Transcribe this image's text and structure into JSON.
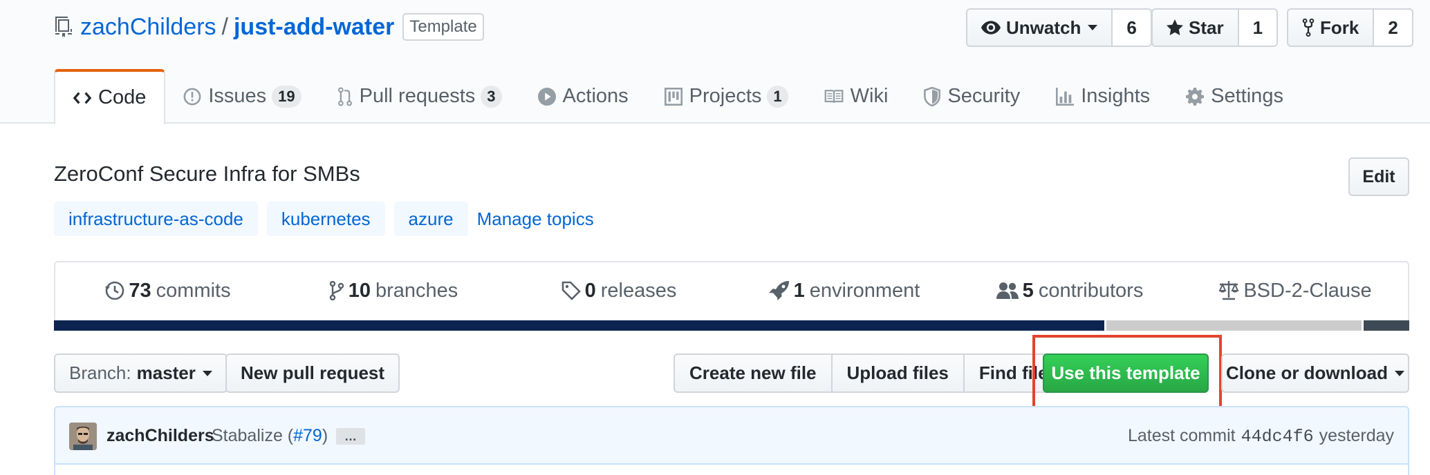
{
  "repo": {
    "owner": "zachChilders",
    "separator": "/",
    "name": "just-add-water",
    "badge": "Template"
  },
  "actions": {
    "watch": {
      "label": "Unwatch",
      "count": "6"
    },
    "star": {
      "label": "Star",
      "count": "1"
    },
    "fork": {
      "label": "Fork",
      "count": "2"
    }
  },
  "tabs": [
    {
      "label": "Code",
      "icon": "code-icon"
    },
    {
      "label": "Issues",
      "count": "19",
      "icon": "issue-icon"
    },
    {
      "label": "Pull requests",
      "count": "3",
      "icon": "pull-request-icon"
    },
    {
      "label": "Actions",
      "icon": "play-icon"
    },
    {
      "label": "Projects",
      "count": "1",
      "icon": "project-icon"
    },
    {
      "label": "Wiki",
      "icon": "book-icon"
    },
    {
      "label": "Security",
      "icon": "shield-icon"
    },
    {
      "label": "Insights",
      "icon": "graph-icon"
    },
    {
      "label": "Settings",
      "icon": "gear-icon"
    }
  ],
  "about": {
    "description": "ZeroConf Secure Infra for SMBs",
    "edit_label": "Edit",
    "topics": [
      "infrastructure-as-code",
      "kubernetes",
      "azure"
    ],
    "manage_topics": "Manage topics"
  },
  "summary": [
    {
      "count": "73",
      "label": "commits",
      "icon": "history-icon"
    },
    {
      "count": "10",
      "label": "branches",
      "icon": "branch-icon"
    },
    {
      "count": "0",
      "label": "releases",
      "icon": "tag-icon"
    },
    {
      "count": "1",
      "label": "environment",
      "icon": "rocket-icon"
    },
    {
      "count": "5",
      "label": "contributors",
      "icon": "people-icon"
    },
    {
      "count": "",
      "label": "BSD-2-Clause",
      "icon": "law-icon"
    }
  ],
  "languages": [
    {
      "share": 0.775,
      "color": "#0d2451"
    },
    {
      "share": 0.19,
      "color": "#cccccc"
    },
    {
      "share": 0.035,
      "color": "#3d4a55"
    }
  ],
  "filebar": {
    "branch_prefix": "Branch:",
    "branch": "master",
    "new_pr": "New pull request",
    "create_file": "Create new file",
    "upload_files": "Upload files",
    "find_file": "Find file",
    "use_template": "Use this template",
    "clone": "Clone or download"
  },
  "commit": {
    "author": "zachChilders",
    "message": "Stabalize (",
    "pr": "#79",
    "message_end": ")",
    "ellipsis": "…",
    "latest_label": "Latest commit",
    "sha": "44dc4f6",
    "time": "yesterday"
  },
  "colors": {
    "accent": "#0366d6",
    "green": "#28a745",
    "highlight": "#e4442d",
    "tab_selected": "#e36209"
  }
}
